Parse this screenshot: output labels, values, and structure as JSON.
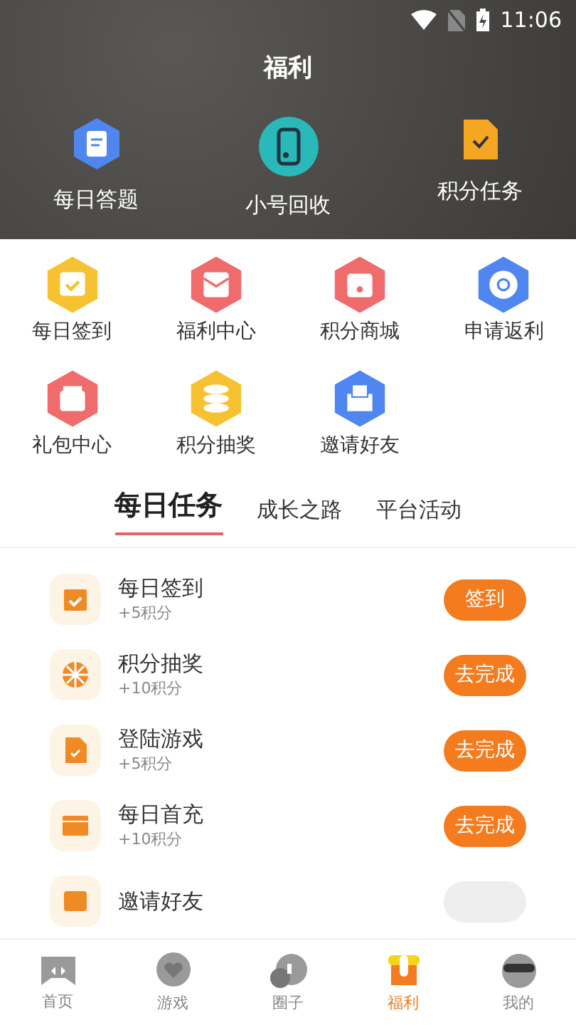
{
  "status_bar": {
    "time": "11:06"
  },
  "header": {
    "title": "福利",
    "shortcuts": [
      {
        "label": "每日答题",
        "kind": "quiz"
      },
      {
        "label": "小号回收",
        "kind": "phone"
      },
      {
        "label": "积分任务",
        "kind": "file"
      }
    ]
  },
  "grid": [
    {
      "label": "每日签到",
      "kind": "calendar",
      "color": "#f7c232"
    },
    {
      "label": "福利中心",
      "kind": "envelope",
      "color": "#f06b6b"
    },
    {
      "label": "积分商城",
      "kind": "bag",
      "color": "#f06b6b"
    },
    {
      "label": "申请返利",
      "kind": "refund",
      "color": "#4f86f0"
    },
    {
      "label": "礼包中心",
      "kind": "gift",
      "color": "#f06b6b"
    },
    {
      "label": "积分抽奖",
      "kind": "coins",
      "color": "#f7c232"
    },
    {
      "label": "邀请好友",
      "kind": "mail",
      "color": "#4f86f0"
    }
  ],
  "tabs": [
    {
      "label": "每日任务",
      "selected": true
    },
    {
      "label": "成长之路",
      "selected": false
    },
    {
      "label": "平台活动",
      "selected": false
    }
  ],
  "tasks": [
    {
      "title": "每日签到",
      "points": "+5积分",
      "button": "签到",
      "kind": "calendar",
      "disabled": false
    },
    {
      "title": "积分抽奖",
      "points": "+10积分",
      "button": "去完成",
      "kind": "wheel",
      "disabled": false
    },
    {
      "title": "登陆游戏",
      "points": "+5积分",
      "button": "去完成",
      "kind": "file",
      "disabled": false
    },
    {
      "title": "每日首充",
      "points": "+10积分",
      "button": "去完成",
      "kind": "wallet",
      "disabled": false
    },
    {
      "title": "邀请好友",
      "kind": "mail",
      "disabled": true
    }
  ],
  "nav": [
    {
      "label": "首页",
      "kind": "home",
      "selected": false
    },
    {
      "label": "游戏",
      "kind": "game",
      "selected": false
    },
    {
      "label": "圈子",
      "kind": "chat",
      "selected": false
    },
    {
      "label": "福利",
      "kind": "gift",
      "selected": true
    },
    {
      "label": "我的",
      "kind": "me",
      "selected": false
    }
  ]
}
